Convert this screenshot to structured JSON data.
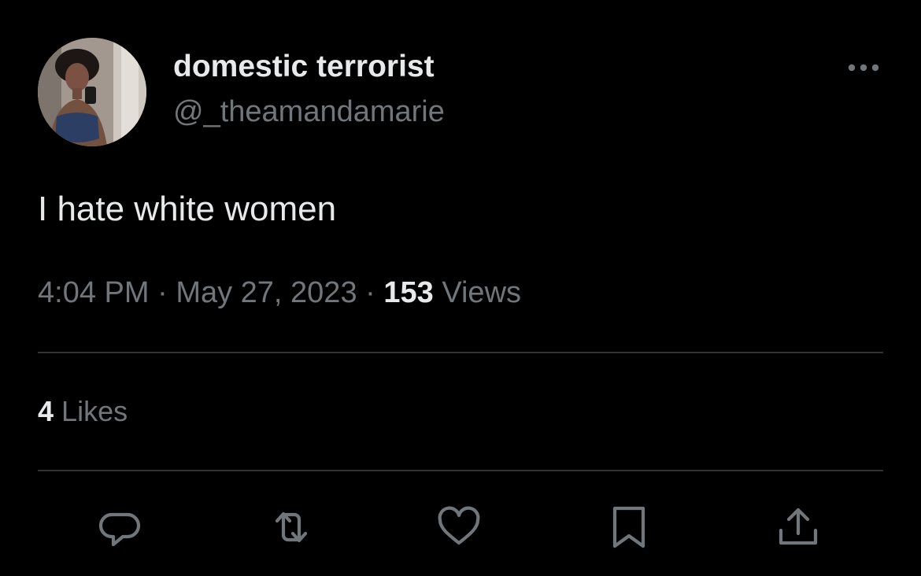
{
  "tweet": {
    "display_name": "domestic terrorist",
    "handle": "@_theamandamarie",
    "text": "I hate white women",
    "time": "4:04 PM",
    "date": "May 27, 2023",
    "views_count": "153",
    "views_label": "Views",
    "separator": "·",
    "likes_count": "4",
    "likes_label": "Likes"
  },
  "icons": {
    "more": "more-horizontal-icon",
    "reply": "reply-bubble-icon",
    "retweet": "retweet-icon",
    "like": "heart-icon",
    "bookmark": "bookmark-icon",
    "share": "share-upload-icon"
  },
  "colors": {
    "background": "#000000",
    "primary_text": "#e7e9ea",
    "secondary_text": "#71767b",
    "divider": "#2f3336"
  }
}
